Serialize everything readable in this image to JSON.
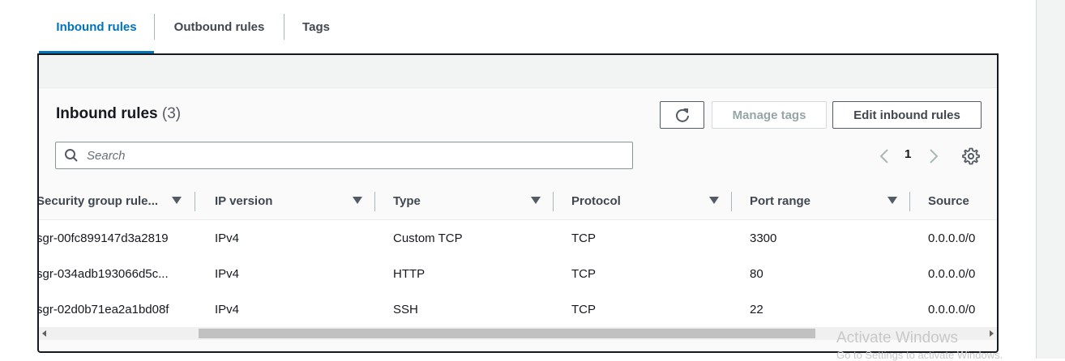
{
  "tabs": [
    {
      "label": "Inbound rules",
      "active": true
    },
    {
      "label": "Outbound rules",
      "active": false
    },
    {
      "label": "Tags",
      "active": false
    }
  ],
  "panel": {
    "title": "Inbound rules",
    "count": "(3)",
    "refresh_icon": "refresh-icon",
    "manage_tags_label": "Manage tags",
    "edit_rules_label": "Edit inbound rules",
    "search_placeholder": "Search",
    "page_number": "1"
  },
  "table": {
    "columns": [
      "Security group rule...",
      "IP version",
      "Type",
      "Protocol",
      "Port range",
      "Source"
    ],
    "rows": [
      [
        "sgr-00fc899147d3a2819",
        "IPv4",
        "Custom TCP",
        "TCP",
        "3300",
        "0.0.0.0/0"
      ],
      [
        "sgr-034adb193066d5c...",
        "IPv4",
        "HTTP",
        "TCP",
        "80",
        "0.0.0.0/0"
      ],
      [
        "sgr-02d0b71ea2a1bd08f",
        "IPv4",
        "SSH",
        "TCP",
        "22",
        "0.0.0.0/0"
      ]
    ]
  },
  "os_watermark": {
    "line1": "Activate Windows",
    "line2": "Go to Settings to activate Windows."
  },
  "colors": {
    "accent": "#0073bb",
    "text": "#16191f",
    "muted": "#545b64",
    "disabled": "#95a5a6"
  }
}
